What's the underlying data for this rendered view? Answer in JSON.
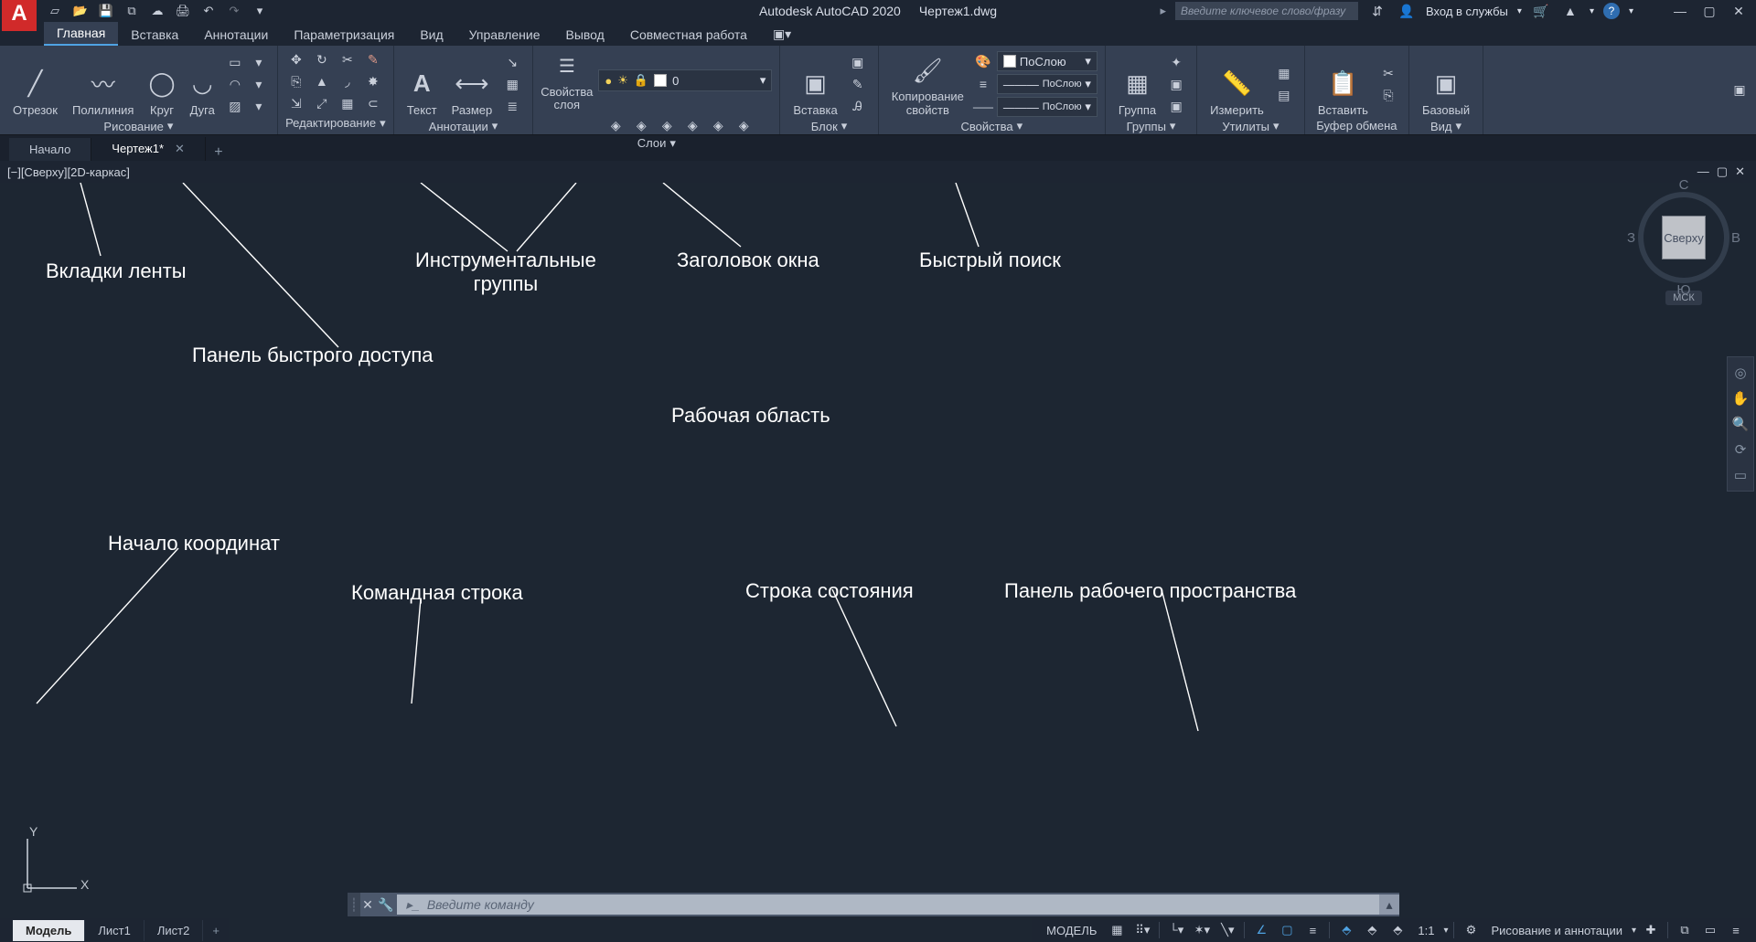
{
  "title": {
    "app": "Autodesk AutoCAD 2020",
    "file": "Чертеж1.dwg"
  },
  "search": {
    "placeholder": "Введите ключевое слово/фразу"
  },
  "signin": "Вход в службы",
  "ribbon_tabs": [
    "Главная",
    "Вставка",
    "Аннотации",
    "Параметризация",
    "Вид",
    "Управление",
    "Вывод",
    "Совместная работа"
  ],
  "ribbon": {
    "draw": {
      "line": "Отрезок",
      "pline": "Полилиния",
      "circle": "Круг",
      "arc": "Дуга",
      "footer": "Рисование"
    },
    "modify": {
      "footer": "Редактирование"
    },
    "annotate": {
      "text": "Текст",
      "dim": "Размер",
      "footer": "Аннотации"
    },
    "layers": {
      "props": "Свойства\nслоя",
      "combo": "0",
      "footer": "Слои"
    },
    "block": {
      "insert": "Вставка",
      "footer": "Блок"
    },
    "props": {
      "match": "Копирование\nсвойств",
      "bylayer": "ПоСлою",
      "footer": "Свойства"
    },
    "groups": {
      "group": "Группа",
      "footer": "Группы"
    },
    "utils": {
      "measure": "Измерить",
      "footer": "Утилиты"
    },
    "clip": {
      "paste": "Вставить",
      "footer": "Буфер обмена"
    },
    "view": {
      "base": "Базовый",
      "footer": "Вид"
    }
  },
  "file_tabs": {
    "start": "Начало",
    "cur": "Чертеж1*"
  },
  "viewport_label": "[−][Сверху][2D-каркас]",
  "viewcube": {
    "face": "Сверху",
    "n": "С",
    "s": "Ю",
    "e": "В",
    "w": "З",
    "wcs": "МСК"
  },
  "ucs": {
    "x": "X",
    "y": "Y"
  },
  "annotations": {
    "tabs": "Вкладки ленты",
    "qat": "Панель быстрого доступа",
    "panels": "Инструментальные\nгруппы",
    "title": "Заголовок окна",
    "search": "Быстрый поиск",
    "workarea": "Рабочая область",
    "origin": "Начало координат",
    "cmd": "Командная строка",
    "status": "Строка состояния",
    "wspanel": "Панель рабочего пространства"
  },
  "cmd": {
    "placeholder": "Введите команду"
  },
  "layout_tabs": {
    "model": "Модель",
    "l1": "Лист1",
    "l2": "Лист2"
  },
  "status": {
    "model": "МОДЕЛЬ",
    "scale": "1:1",
    "ws": "Рисование и аннотации"
  }
}
